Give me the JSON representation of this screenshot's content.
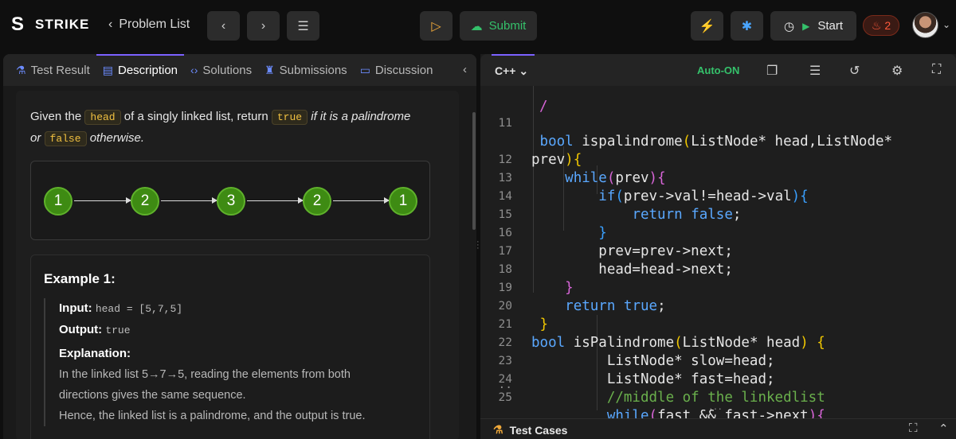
{
  "topbar": {
    "brand": "STRIKE",
    "problem_list": "Problem List",
    "submit": "Submit",
    "start": "Start",
    "streak": "2",
    "accent_purple": "#7b61ff",
    "accent_green": "#35c16b"
  },
  "left_tabs": {
    "test_result": "Test Result",
    "description": "Description",
    "solutions": "Solutions",
    "submissions": "Submissions",
    "discussion": "Discussion"
  },
  "description": {
    "p1": "Given the",
    "chip_head": "head",
    "p2": "of a singly linked list, return",
    "chip_true": "true",
    "p3": "if it is a palindrome",
    "p4": "or",
    "chip_false": "false",
    "p5": "otherwise."
  },
  "linked_list": [
    "1",
    "2",
    "3",
    "2",
    "1"
  ],
  "example": {
    "title": "Example 1:",
    "input_label": "Input:",
    "input_value": "head = [5,7,5]",
    "output_label": "Output:",
    "output_value": "true",
    "explanation_label": "Explanation:",
    "explanation_1": "In the linked list 5→7→5, reading the elements from both",
    "explanation_2": "directions gives the same sequence.",
    "explanation_3": "Hence, the linked list is a palindrome, and the output is true."
  },
  "editor": {
    "language": "C++",
    "auto": "Auto-ON",
    "test_cases": "Test Cases"
  },
  "code_lines": [
    {
      "n": "11",
      "text": " bool ispalindrome(ListNode* head,ListNode*"
    },
    {
      "n": "",
      "text": "prev){"
    },
    {
      "n": "12",
      "text": "    while(prev){"
    },
    {
      "n": "13",
      "text": "        if(prev->val!=head->val){"
    },
    {
      "n": "14",
      "text": "            return false;"
    },
    {
      "n": "15",
      "text": "        }"
    },
    {
      "n": "16",
      "text": "        prev=prev->next;"
    },
    {
      "n": "17",
      "text": "        head=head->next;"
    },
    {
      "n": "18",
      "text": "    }"
    },
    {
      "n": "19",
      "text": "    return true;"
    },
    {
      "n": "20",
      "text": " }"
    },
    {
      "n": "21",
      "text": "bool isPalindrome(ListNode* head) {"
    },
    {
      "n": "22",
      "text": "         ListNode* slow=head;"
    },
    {
      "n": "23",
      "text": "         ListNode* fast=head;"
    },
    {
      "n": "24",
      "text": "         //middle of the linkedlist"
    },
    {
      "n": "25",
      "text": "         while(fast && fast->next){"
    }
  ]
}
